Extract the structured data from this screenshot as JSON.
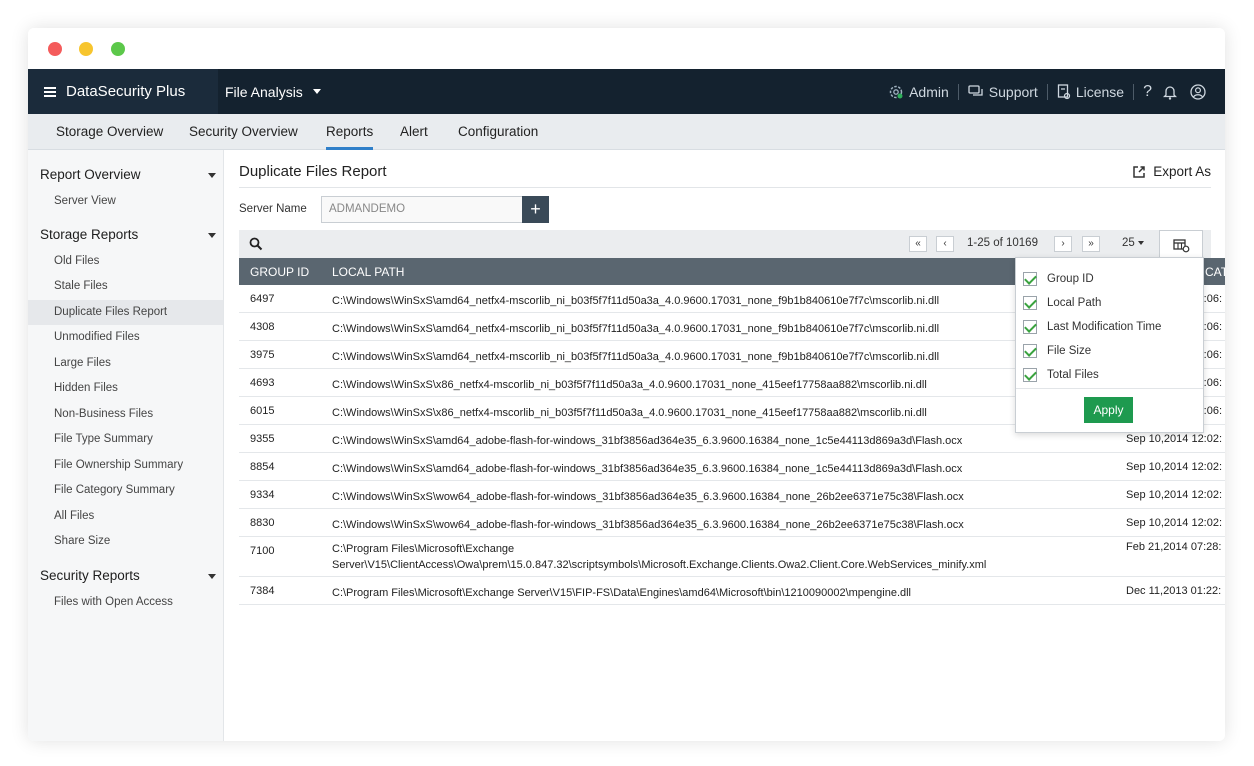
{
  "app": {
    "brand": "DataSecurity Plus",
    "module": "File Analysis",
    "admin": "Admin",
    "support": "Support",
    "license": "License",
    "help": "?"
  },
  "tabs": [
    "Storage Overview",
    "Security Overview",
    "Reports",
    "Alert",
    "Configuration"
  ],
  "active_tab": "Reports",
  "sidebar": {
    "report_overview": "Report Overview",
    "report_overview_items": [
      "Server View"
    ],
    "storage_reports": "Storage Reports",
    "storage_items": [
      "Old Files",
      "Stale Files",
      "Duplicate Files Report",
      "Unmodified Files",
      "Large Files",
      "Hidden Files",
      "Non-Business Files",
      "File Type Summary",
      "File Ownership Summary",
      "File Category Summary",
      "All Files",
      "Share Size"
    ],
    "security_reports": "Security Reports",
    "security_items": [
      "Files with Open Access"
    ],
    "active_item": "Duplicate Files Report"
  },
  "report": {
    "title": "Duplicate Files Report",
    "export_label": "Export As",
    "server_label": "Server Name",
    "server_value": "ADMANDEMO",
    "add_label": "+",
    "pagination": "1-25 of 10169",
    "page_size": "25"
  },
  "table": {
    "headers": [
      "GROUP ID",
      "LOCAL PATH",
      "CAT"
    ],
    "rows": [
      {
        "id": "6497",
        "path": "C:\\Windows\\WinSxS\\amd64_netfx4-mscorlib_ni_b03f5f7f11d50a3a_4.0.9600.17031_none_f9b1b840610e7f7c\\mscorlib.ni.dll",
        "time": "Sep 10,2014 06:06:"
      },
      {
        "id": "4308",
        "path": "C:\\Windows\\WinSxS\\amd64_netfx4-mscorlib_ni_b03f5f7f11d50a3a_4.0.9600.17031_none_f9b1b840610e7f7c\\mscorlib.ni.dll",
        "time": "Sep 10,2014 06:06:"
      },
      {
        "id": "3975",
        "path": "C:\\Windows\\WinSxS\\amd64_netfx4-mscorlib_ni_b03f5f7f11d50a3a_4.0.9600.17031_none_f9b1b840610e7f7c\\mscorlib.ni.dll",
        "time": "Sep 10,2014 06:06:"
      },
      {
        "id": "4693",
        "path": "C:\\Windows\\WinSxS\\x86_netfx4-mscorlib_ni_b03f5f7f11d50a3a_4.0.9600.17031_none_415eef17758aa882\\mscorlib.ni.dll",
        "time": "Sep 10,2014 06:06:"
      },
      {
        "id": "6015",
        "path": "C:\\Windows\\WinSxS\\x86_netfx4-mscorlib_ni_b03f5f7f11d50a3a_4.0.9600.17031_none_415eef17758aa882\\mscorlib.ni.dll",
        "time": "Sep 10,2014 06:06:"
      },
      {
        "id": "9355",
        "path": "C:\\Windows\\WinSxS\\amd64_adobe-flash-for-windows_31bf3856ad364e35_6.3.9600.16384_none_1c5e44113d869a3d\\Flash.ocx",
        "time": "Sep 10,2014 12:02:"
      },
      {
        "id": "8854",
        "path": "C:\\Windows\\WinSxS\\amd64_adobe-flash-for-windows_31bf3856ad364e35_6.3.9600.16384_none_1c5e44113d869a3d\\Flash.ocx",
        "time": "Sep 10,2014 12:02:"
      },
      {
        "id": "9334",
        "path": "C:\\Windows\\WinSxS\\wow64_adobe-flash-for-windows_31bf3856ad364e35_6.3.9600.16384_none_26b2ee6371e75c38\\Flash.ocx",
        "time": "Sep 10,2014 12:02:"
      },
      {
        "id": "8830",
        "path": "C:\\Windows\\WinSxS\\wow64_adobe-flash-for-windows_31bf3856ad364e35_6.3.9600.16384_none_26b2ee6371e75c38\\Flash.ocx",
        "time": "Sep 10,2014 12:02:"
      },
      {
        "id": "7100",
        "path": "C:\\Program Files\\Microsoft\\Exchange Server\\V15\\ClientAccess\\Owa\\prem\\15.0.847.32\\scriptsymbols\\Microsoft.Exchange.Clients.Owa2.Client.Core.WebServices_minify.xml",
        "time": "Feb 21,2014 07:28:"
      },
      {
        "id": "7384",
        "path": "C:\\Program Files\\Microsoft\\Exchange Server\\V15\\FIP-FS\\Data\\Engines\\amd64\\Microsoft\\bin\\1210090002\\mpengine.dll",
        "time": "Dec 11,2013 01:22:"
      }
    ]
  },
  "column_picker": {
    "options": [
      "Group ID",
      "Local Path",
      "Last Modification Time",
      "File Size",
      "Total Files"
    ],
    "apply_label": "Apply"
  },
  "colors": {
    "topbar": "#14222f",
    "active_tab_underline": "#2f7fc9",
    "table_header": "#5a6670",
    "apply_button": "#1e9a4f",
    "checkmark": "#3aa33f"
  }
}
